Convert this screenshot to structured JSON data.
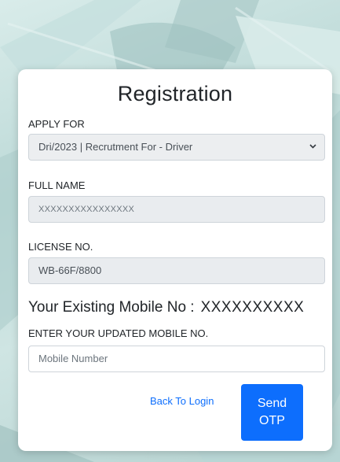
{
  "form": {
    "title": "Registration",
    "apply_for": {
      "label": "APPLY FOR",
      "selected": "Dri/2023 | Recrutment For - Driver"
    },
    "full_name": {
      "label": "FULL NAME",
      "value": "XXXXXXXXXXXXXXXX"
    },
    "license": {
      "label": "LICENSE NO.",
      "value": "WB-66F/8800"
    },
    "existing_mobile": {
      "label": "Your Existing Mobile No :",
      "value": "XXXXXXXXXX"
    },
    "updated_mobile": {
      "label": "ENTER YOUR UPDATED MOBILE NO.",
      "placeholder": "Mobile Number",
      "value": ""
    },
    "back_link": "Back To Login",
    "send_button": "Send OTP"
  },
  "colors": {
    "primary": "#0d6efd",
    "readonly_bg": "#e9ecef",
    "text": "#212529"
  }
}
